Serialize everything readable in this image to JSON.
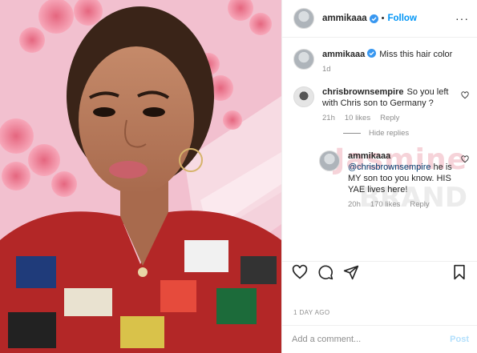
{
  "header": {
    "username": "ammikaaa",
    "separator": "•",
    "follow_label": "Follow",
    "more_label": "···"
  },
  "caption": {
    "username": "ammikaaa",
    "text": "Miss this hair color",
    "time": "1d"
  },
  "comment1": {
    "username": "chrisbrownsempire",
    "text": "So you left with Chris son to Germany ?",
    "time": "21h",
    "likes": "10 likes",
    "reply_label": "Reply",
    "hide_replies_label": "Hide replies"
  },
  "reply1": {
    "username": "ammikaaa",
    "mention": "@chrisbrownsempire",
    "text": "he is MY son too you know. HIS YAE lives here!",
    "time": "20h",
    "likes": "170 likes",
    "reply_label": "Reply"
  },
  "watermark": {
    "line1": "Jasmine",
    "line2": "BRAND"
  },
  "actions": {
    "like_icon": "heart-icon",
    "comment_icon": "comment-icon",
    "share_icon": "share-icon",
    "save_icon": "bookmark-icon"
  },
  "post_time": "1 DAY AGO",
  "add_comment": {
    "placeholder": "Add a comment...",
    "post_label": "Post"
  },
  "colors": {
    "link_blue": "#0095f6",
    "post_disabled": "#b2dffc",
    "verified_blue": "#3897f0"
  }
}
